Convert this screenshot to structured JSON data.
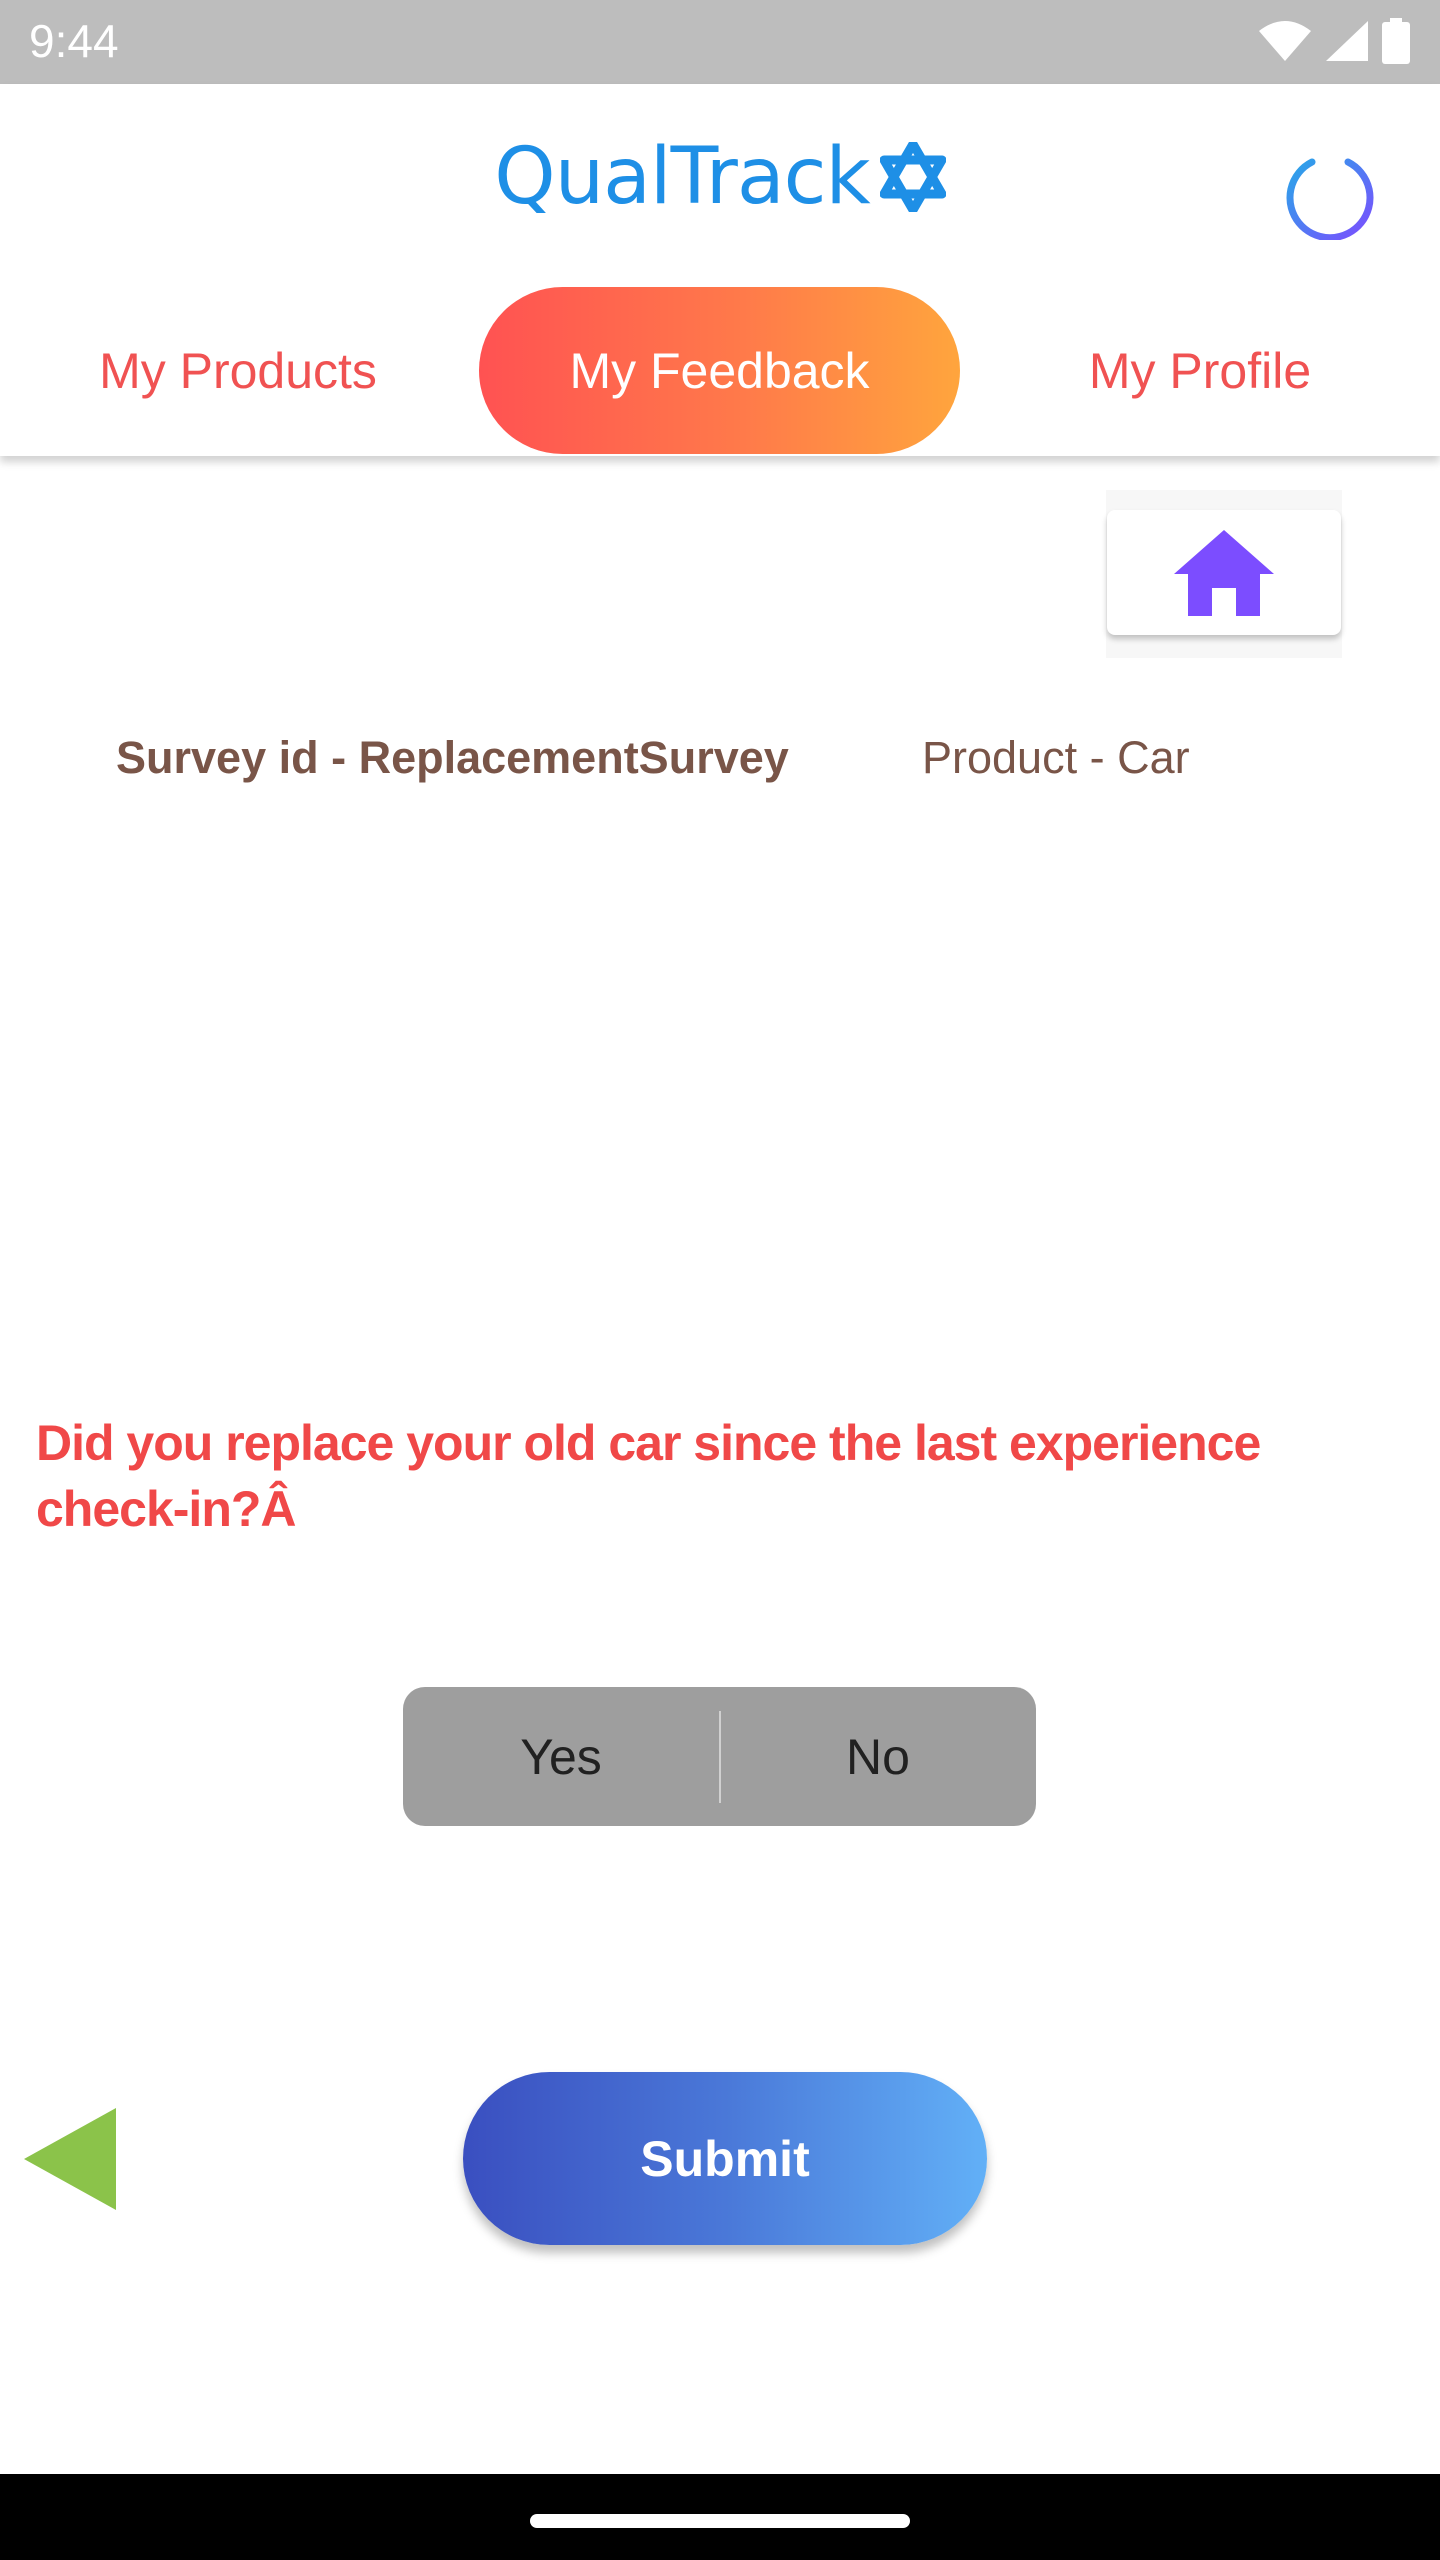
{
  "status_bar": {
    "time": "9:44",
    "icons": [
      "wifi-icon",
      "signal-icon",
      "battery-icon"
    ]
  },
  "header": {
    "brand": "QualTrack",
    "brand_icon": "star-of-david-icon",
    "power_icon": "power-icon",
    "colors": {
      "brand": "#1e8fe6",
      "tab_text": "#f05252"
    }
  },
  "tabs": [
    {
      "label": "My Products",
      "active": false
    },
    {
      "label": "My Feedback",
      "active": true
    },
    {
      "label": "My Profile",
      "active": false
    }
  ],
  "home_button": {
    "icon": "home-icon",
    "color": "#7c4dff"
  },
  "survey": {
    "id_text": "Survey id - ReplacementSurvey",
    "product_text": "Product - Car"
  },
  "question": {
    "text": "Did you replace your old car since the last experience check-in?Â"
  },
  "answer_options": {
    "yes": "Yes",
    "no": "No"
  },
  "actions": {
    "back_icon": "back-triangle-icon",
    "submit_label": "Submit"
  }
}
